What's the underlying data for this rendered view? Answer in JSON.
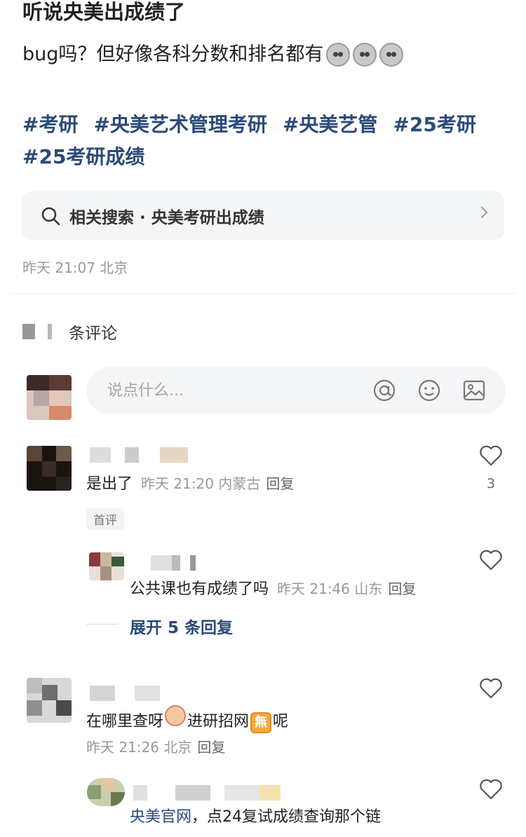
{
  "post": {
    "title": "听说央美出成绩了",
    "body": "bug吗？但好像各科分数和排名都有",
    "tags": [
      "#考研",
      "#央美艺术管理考研",
      "#央美艺管",
      "#25考研",
      "#25考研成绩"
    ],
    "related_search": "相关搜索 · 央美考研出成绩",
    "meta": "昨天 21:07 北京"
  },
  "comments_header": "条评论",
  "input": {
    "placeholder": "说点什么..."
  },
  "comments": [
    {
      "text": "是出了",
      "time": "昨天 21:20 内蒙古",
      "reply_label": "回复",
      "likes": "3",
      "badge": "首评",
      "sub": {
        "text": "公共课也有成绩了吗",
        "time": "昨天 21:46 山东",
        "reply_label": "回复"
      },
      "expand": "展开 5 条回复"
    },
    {
      "text_a": "在哪里查呀",
      "text_b": "进研招网",
      "emoji_b": "無",
      "text_c": "呢",
      "time": "昨天 21:26 北京",
      "reply_label": "回复",
      "sub": {
        "link": "央美官网",
        "text": "，点24复试成绩查询那个链"
      }
    }
  ],
  "icons": {
    "search": "search-icon",
    "chevron": "chevron-right-icon",
    "at": "at-icon",
    "emoji": "emoji-icon",
    "image": "image-icon",
    "heart": "heart-icon"
  },
  "colors": {
    "accent": "#2a4a78",
    "muted": "#999999",
    "input_bg": "#f4f5f6"
  }
}
